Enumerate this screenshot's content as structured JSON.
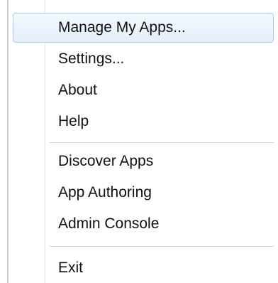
{
  "menu": {
    "groups": [
      {
        "items": [
          {
            "label": "Manage My Apps...",
            "highlighted": true
          },
          {
            "label": "Settings..."
          },
          {
            "label": "About"
          },
          {
            "label": "Help"
          }
        ]
      },
      {
        "items": [
          {
            "label": "Discover Apps"
          },
          {
            "label": "App Authoring"
          },
          {
            "label": "Admin Console"
          }
        ]
      },
      {
        "items": [
          {
            "label": "Exit"
          }
        ]
      }
    ],
    "colors": {
      "highlight_border": "#aecbee",
      "highlight_fill": "#e4effc",
      "text": "#111111",
      "separator": "#d6d6d6"
    }
  }
}
